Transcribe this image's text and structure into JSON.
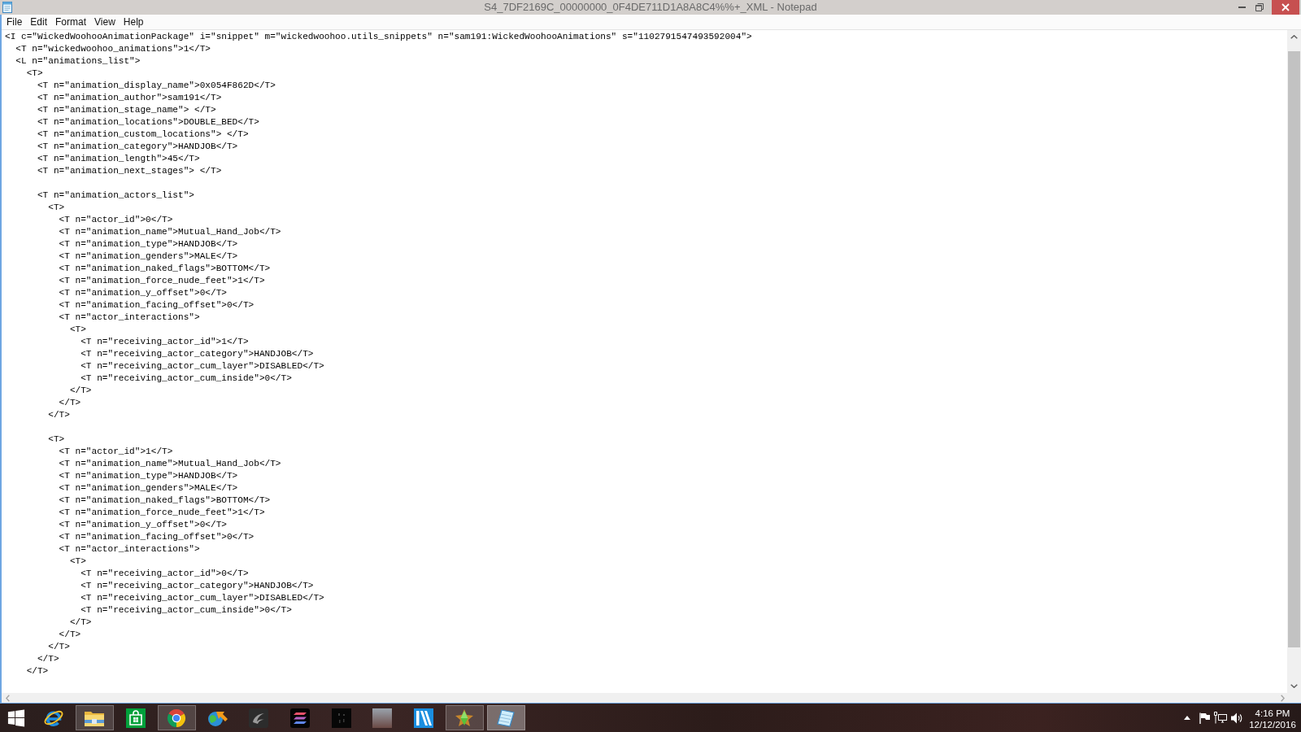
{
  "window": {
    "title": "S4_7DF2169C_00000000_0F4DE711D1A8A8C4%%+_XML - Notepad"
  },
  "menu": [
    "File",
    "Edit",
    "Format",
    "View",
    "Help"
  ],
  "document": {
    "lines": [
      {
        "line": "<I c=\"WickedWoohooAnimationPackage\" i=\"snippet\" m=\"wickedwoohoo.utils_snippets\" n=\"sam191:WickedWoohooAnimations\" s=\"1102791547493592004\">",
        "children": [
          {
            "line": "<T n=\"wickedwoohoo_animations\">1</T>"
          },
          {
            "line": "<L n=\"animations_list\">",
            "children": [
              {
                "line": "<T>",
                "sections": [
                  [
                    {
                      "line": "<T n=\"animation_display_name\">0x054F862D</T>"
                    },
                    {
                      "line": "<T n=\"animation_author\">sam191</T>"
                    },
                    {
                      "line": "<T n=\"animation_stage_name\"> </T>"
                    },
                    {
                      "line": "<T n=\"animation_locations\">DOUBLE_BED</T>"
                    },
                    {
                      "line": "<T n=\"animation_custom_locations\"> </T>"
                    },
                    {
                      "line": "<T n=\"animation_category\">HANDJOB</T>"
                    },
                    {
                      "line": "<T n=\"animation_length\">45</T>"
                    },
                    {
                      "line": "<T n=\"animation_next_stages\"> </T>"
                    }
                  ],
                  [
                    {
                      "line": "<T n=\"animation_actors_list\">",
                      "sections": [
                        [
                          {
                            "line": "<T>",
                            "children": [
                              {
                                "line": "<T n=\"actor_id\">0</T>"
                              },
                              {
                                "line": "<T n=\"animation_name\">Mutual_Hand_Job</T>"
                              },
                              {
                                "line": "<T n=\"animation_type\">HANDJOB</T>"
                              },
                              {
                                "line": "<T n=\"animation_genders\">MALE</T>"
                              },
                              {
                                "line": "<T n=\"animation_naked_flags\">BOTTOM</T>"
                              },
                              {
                                "line": "<T n=\"animation_force_nude_feet\">1</T>"
                              },
                              {
                                "line": "<T n=\"animation_y_offset\">0</T>"
                              },
                              {
                                "line": "<T n=\"animation_facing_offset\">0</T>"
                              },
                              {
                                "line": "<T n=\"actor_interactions\">",
                                "children": [
                                  {
                                    "line": "<T>",
                                    "children": [
                                      {
                                        "line": "<T n=\"receiving_actor_id\">1</T>"
                                      },
                                      {
                                        "line": "<T n=\"receiving_actor_category\">HANDJOB</T>"
                                      },
                                      {
                                        "line": "<T n=\"receiving_actor_cum_layer\">DISABLED</T>"
                                      },
                                      {
                                        "line": "<T n=\"receiving_actor_cum_inside\">0</T>"
                                      }
                                    ],
                                    "end": "</T>"
                                  }
                                ],
                                "end": "</T>"
                              }
                            ],
                            "end": "</T>"
                          }
                        ],
                        [
                          {
                            "line": "<T>",
                            "children": [
                              {
                                "line": "<T n=\"actor_id\">1</T>"
                              },
                              {
                                "line": "<T n=\"animation_name\">Mutual_Hand_Job</T>"
                              },
                              {
                                "line": "<T n=\"animation_type\">HANDJOB</T>"
                              },
                              {
                                "line": "<T n=\"animation_genders\">MALE</T>"
                              },
                              {
                                "line": "<T n=\"animation_naked_flags\">BOTTOM</T>"
                              },
                              {
                                "line": "<T n=\"animation_force_nude_feet\">1</T>"
                              },
                              {
                                "line": "<T n=\"animation_y_offset\">0</T>"
                              },
                              {
                                "line": "<T n=\"animation_facing_offset\">0</T>"
                              },
                              {
                                "line": "<T n=\"actor_interactions\">",
                                "children": [
                                  {
                                    "line": "<T>",
                                    "children": [
                                      {
                                        "line": "<T n=\"receiving_actor_id\">0</T>"
                                      },
                                      {
                                        "line": "<T n=\"receiving_actor_category\">HANDJOB</T>"
                                      },
                                      {
                                        "line": "<T n=\"receiving_actor_cum_layer\">DISABLED</T>"
                                      },
                                      {
                                        "line": "<T n=\"receiving_actor_cum_inside\">0</T>"
                                      }
                                    ],
                                    "end": "</T>"
                                  }
                                ],
                                "end": "</T>"
                              }
                            ],
                            "end": "</T>"
                          }
                        ]
                      ],
                      "end": "</T>"
                    }
                  ]
                ],
                "end": "</T>"
              }
            ]
          }
        ]
      }
    ]
  },
  "taskbar": {
    "apps": [
      {
        "kind": "eglobe",
        "running": false,
        "selected": false
      },
      {
        "kind": "folder",
        "running": true,
        "selected": false
      },
      {
        "kind": "bag",
        "running": false,
        "selected": false
      },
      {
        "kind": "ringball",
        "running": true,
        "selected": false
      },
      {
        "kind": "globearrow",
        "running": false,
        "selected": false
      },
      {
        "kind": "swirl",
        "running": false,
        "selected": false
      },
      {
        "kind": "stripes",
        "running": false,
        "selected": false
      },
      {
        "kind": "darktile",
        "running": false,
        "selected": false
      },
      {
        "kind": "picture",
        "running": false,
        "selected": false
      },
      {
        "kind": "diagonal",
        "running": false,
        "selected": false
      },
      {
        "kind": "crystal",
        "running": true,
        "selected": false
      },
      {
        "kind": "notepad",
        "running": true,
        "selected": true
      }
    ],
    "clock": {
      "time": "4:16 PM",
      "date": "12/12/2016"
    }
  }
}
